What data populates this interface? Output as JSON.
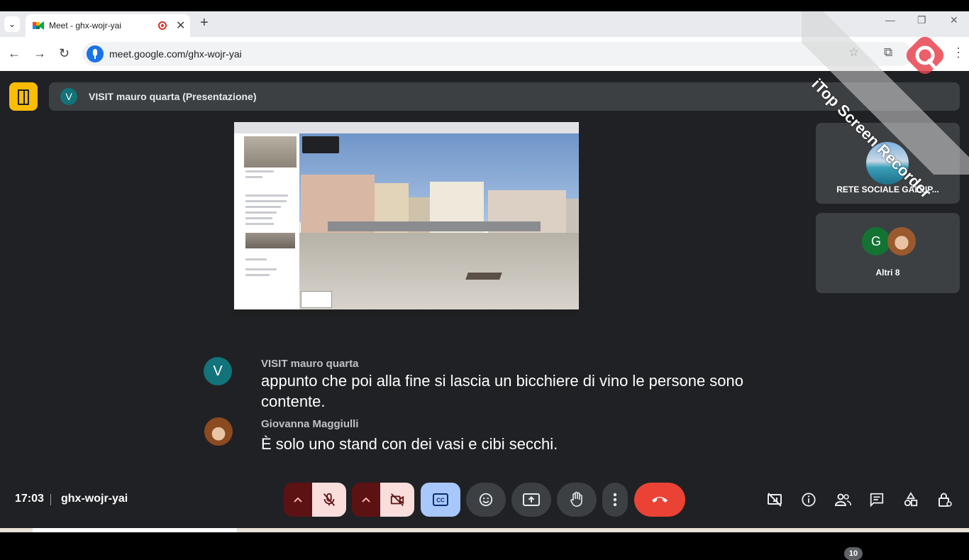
{
  "browser": {
    "tab_title": "Meet - ghx-wojr-yai",
    "url": "meet.google.com/ghx-wojr-yai",
    "tab_close": "✕",
    "new_tab": "+"
  },
  "meeting": {
    "presenter_initial": "V",
    "presentation_title": "VISIT mauro quarta (Presentazione)",
    "time": "17:03",
    "code": "ghx-wojr-yai"
  },
  "tiles": [
    {
      "name": "RETE SOCIALE GALLIP..."
    },
    {
      "initial": "G",
      "name": "Altri 8"
    }
  ],
  "captions": [
    {
      "initial": "V",
      "speaker": "VISIT mauro quarta",
      "text": "appunto che poi alla fine si lascia un bicchiere di vino le persone sono contente."
    },
    {
      "speaker": "Giovanna Maggiulli",
      "text": "È solo uno stand con dei vasi e cibi secchi."
    }
  ],
  "participants_count": "10",
  "watermark": "iTop Screen Recorder",
  "colors": {
    "meet_bg": "#202124",
    "surface": "#3c4043",
    "accent_yellow": "#fbbc04",
    "end_call": "#ea4335",
    "muted_bg": "#f9dedc",
    "captions_active": "#a8c7fa"
  }
}
